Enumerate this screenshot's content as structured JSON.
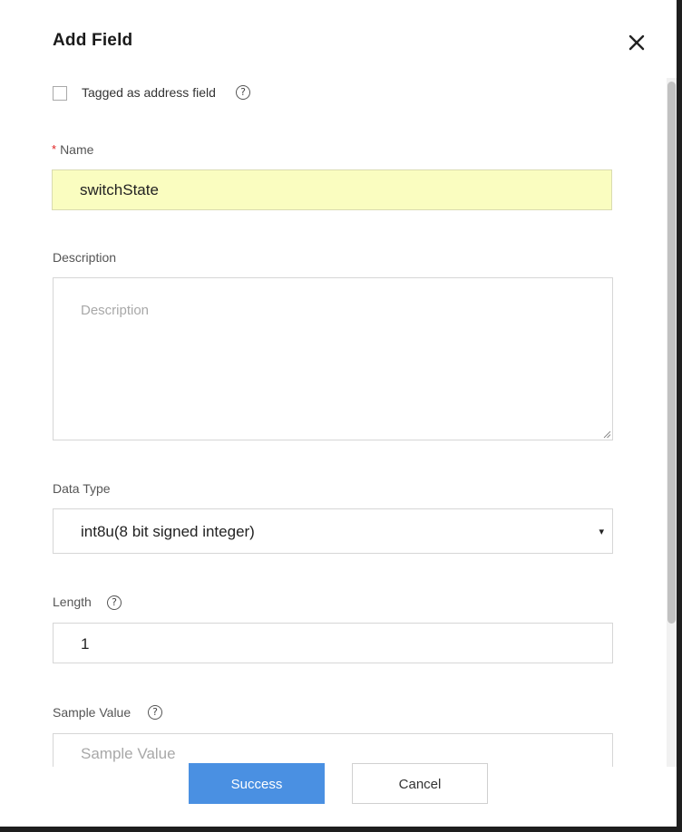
{
  "dialog": {
    "title": "Add Field"
  },
  "address_checkbox": {
    "label": "Tagged as address field",
    "checked": false
  },
  "name": {
    "required_mark": "*",
    "label": "Name",
    "value": "switchState"
  },
  "description": {
    "label": "Description",
    "placeholder": "Description",
    "value": ""
  },
  "data_type": {
    "label": "Data Type",
    "selected": "int8u(8 bit signed integer)"
  },
  "length": {
    "label": "Length",
    "value": "1"
  },
  "sample_value": {
    "label": "Sample Value",
    "placeholder": "Sample Value",
    "value": ""
  },
  "help_glyph": "?",
  "dropdown_caret": "▾",
  "buttons": {
    "success_label": "Success",
    "cancel_label": "Cancel"
  },
  "colors": {
    "primary": "#4a90e2",
    "name_highlight": "#fafdc0",
    "required": "#e02020"
  },
  "icons": [
    "close-icon",
    "help-icon",
    "chevron-down-icon",
    "resize-handle-icon"
  ]
}
